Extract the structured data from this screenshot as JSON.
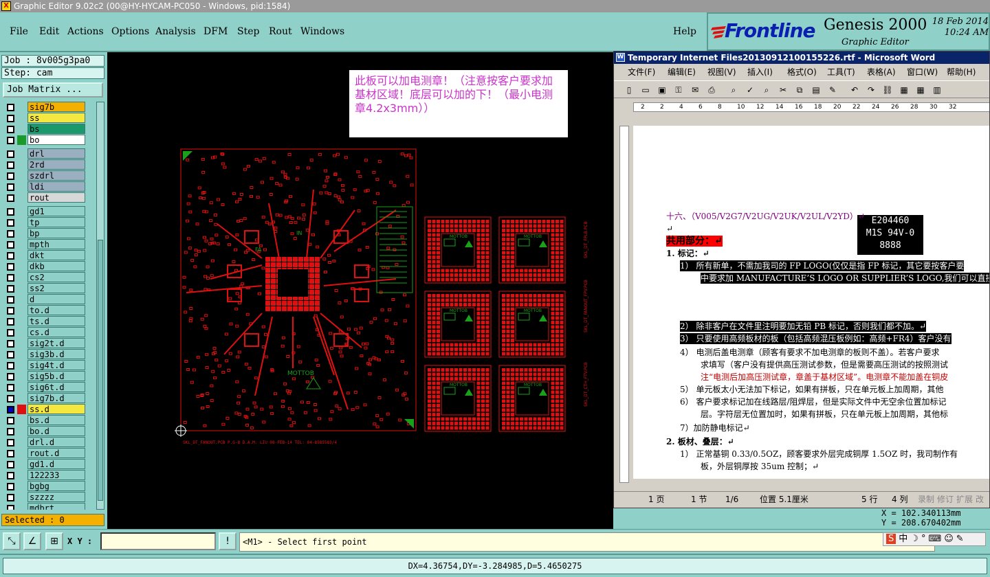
{
  "window": {
    "title": "Graphic Editor 9.02c2 (00@HY-HYCAM-PC050 - Windows, pid:1584)",
    "icon": "X"
  },
  "menu": [
    "File",
    "Edit",
    "Actions",
    "Options",
    "Analysis",
    "DFM",
    "Step",
    "Rout",
    "Windows"
  ],
  "help": "Help",
  "logo": {
    "brand": "Frontline",
    "product": "Genesis 2000",
    "subtitle": "Graphic Editor",
    "date": "18 Feb 2014",
    "time": "10:24 AM"
  },
  "left": {
    "job": "Job : 8v005g3pa0",
    "step": "Step: cam",
    "job_matrix": "Job Matrix ...",
    "selected": "Selected : 0",
    "layers": [
      {
        "name": "sig7b",
        "bg": "#f4b000",
        "sw": ""
      },
      {
        "name": "ss",
        "bg": "#f4e840",
        "sw": ""
      },
      {
        "name": "bs",
        "bg": "#1a9a6a",
        "sw": ""
      },
      {
        "name": "bo",
        "bg": "#ffffff",
        "sw": "#1a9a2a"
      },
      {
        "name": "",
        "bg": "",
        "sw": "",
        "gap": true
      },
      {
        "name": "drl",
        "bg": "#9ab0c0",
        "sw": ""
      },
      {
        "name": "2rd",
        "bg": "#9ab0c0",
        "sw": ""
      },
      {
        "name": "szdrl",
        "bg": "#9ab0c0",
        "sw": ""
      },
      {
        "name": "ldi",
        "bg": "#9ab0c0",
        "sw": ""
      },
      {
        "name": "rout",
        "bg": "#d8d8d8",
        "sw": ""
      },
      {
        "name": "",
        "bg": "",
        "sw": "",
        "gap": true
      },
      {
        "name": "gd1",
        "bg": "#8fd0c8",
        "sw": ""
      },
      {
        "name": "tp",
        "bg": "#8fd0c8",
        "sw": ""
      },
      {
        "name": "bp",
        "bg": "#8fd0c8",
        "sw": ""
      },
      {
        "name": "mpth",
        "bg": "#8fd0c8",
        "sw": ""
      },
      {
        "name": "dkt",
        "bg": "#8fd0c8",
        "sw": ""
      },
      {
        "name": "dkb",
        "bg": "#8fd0c8",
        "sw": ""
      },
      {
        "name": "cs2",
        "bg": "#8fd0c8",
        "sw": ""
      },
      {
        "name": "ss2",
        "bg": "#8fd0c8",
        "sw": ""
      },
      {
        "name": "d",
        "bg": "#8fd0c8",
        "sw": ""
      },
      {
        "name": "to.d",
        "bg": "#8fd0c8",
        "sw": ""
      },
      {
        "name": "ts.d",
        "bg": "#8fd0c8",
        "sw": ""
      },
      {
        "name": "cs.d",
        "bg": "#8fd0c8",
        "sw": ""
      },
      {
        "name": "sig2t.d",
        "bg": "#8fd0c8",
        "sw": ""
      },
      {
        "name": "sig3b.d",
        "bg": "#8fd0c8",
        "sw": ""
      },
      {
        "name": "sig4t.d",
        "bg": "#8fd0c8",
        "sw": ""
      },
      {
        "name": "sig5b.d",
        "bg": "#8fd0c8",
        "sw": ""
      },
      {
        "name": "sig6t.d",
        "bg": "#8fd0c8",
        "sw": ""
      },
      {
        "name": "sig7b.d",
        "bg": "#8fd0c8",
        "sw": ""
      },
      {
        "name": "ss.d",
        "bg": "#f4e840",
        "sw": "#e01010",
        "active": true
      },
      {
        "name": "bs.d",
        "bg": "#8fd0c8",
        "sw": ""
      },
      {
        "name": "bo.d",
        "bg": "#8fd0c8",
        "sw": ""
      },
      {
        "name": "drl.d",
        "bg": "#8fd0c8",
        "sw": ""
      },
      {
        "name": "rout.d",
        "bg": "#8fd0c8",
        "sw": ""
      },
      {
        "name": "gd1.d",
        "bg": "#8fd0c8",
        "sw": ""
      },
      {
        "name": "122233",
        "bg": "#8fd0c8",
        "sw": ""
      },
      {
        "name": "bgbg",
        "bg": "#8fd0c8",
        "sw": ""
      },
      {
        "name": "szzzz",
        "bg": "#8fd0c8",
        "sw": ""
      },
      {
        "name": "mdbrt",
        "bg": "#8fd0c8",
        "sw": ""
      }
    ]
  },
  "canvas": {
    "note": "此板可以加电测章！（注意按客户要求加基材区域！底层可以加的下！（最小电测章4.2x3mm））",
    "pcb_caption": "SKL_DT_FANOUT.PCB     P.G-8     D.A.M. LIU  08-FEB-14  TEL: 04-8585583/4",
    "board_labels": [
      "IN",
      "FA",
      "MOTTOB"
    ],
    "side_labels": [
      "SKL_DT_FPLB.PCB",
      "SKL_DT_FANOUT_FPV.PCB",
      "SKL_DT_CTH_FTV.PCB"
    ],
    "unit_label": "MOTTOB"
  },
  "word": {
    "title": "Temporary Internet Files20130912100155226.rtf - Microsoft Word",
    "menu": [
      "文件(F)",
      "编辑(E)",
      "视图(V)",
      "插入(I)",
      "格式(O)",
      "工具(T)",
      "表格(A)",
      "窗口(W)",
      "帮助(H)"
    ],
    "ruler_nums": [
      "2",
      "2",
      "4",
      "6",
      "8",
      "10",
      "12",
      "14",
      "16",
      "18",
      "20",
      "22",
      "24",
      "26",
      "28",
      "30",
      "32"
    ],
    "lines": [
      {
        "t": "十六、（V005/V2G7/V2UG/V2UK/V2UL/V2YD）↵",
        "c": "#800080"
      },
      {
        "t": "↵",
        "c": "#000"
      },
      {
        "t": "共用部分：↵",
        "c": "#000",
        "bg": "#ff0000"
      },
      {
        "t": "1.  标记：↵",
        "c": "#000",
        "b": true
      },
      {
        "t": "1） 所有新单，不需加我司的 FP LOGO(仅仅是指 FP 标记，其它要按客户要",
        "hl": true
      },
      {
        "t": "中要求加 MANUFACTURE’S LOGO OR SUPPLIER’S LOGO,我们可以直接",
        "hl": true
      },
      {
        "t": "2） 除非客户在文件里注明要加无铅 PB 标记，否则我们都不加。↵",
        "hl": true
      },
      {
        "t": "3） 只要使用高频板材的板（包括高频混压板例如：高频+FR4）客户没有",
        "hl": true
      },
      {
        "t": "4） 电测后盖电测章（顾客有要求不加电测章的板则不盖）。若客户要求",
        "c": "#000"
      },
      {
        "t": "求填写（客户没有提供高压测试参数，但是需要高压测试的按照测试",
        "c": "#000"
      },
      {
        "t": "注“电测后加高压测试章，章盖于基材区域”。电测章不能加盖在铜皮",
        "c": "#c00000"
      },
      {
        "t": "5） 单元板太小无法加下标记，如果有拼板，只在单元板上加周期，其他",
        "c": "#000"
      },
      {
        "t": "6） 客户要求标记加在线路层/阻焊层，但是实际文件中无空余位置加标记",
        "c": "#000"
      },
      {
        "t": "层。字符层无位置加时，如果有拼板，只在单元板上加周期，其他标",
        "c": "#000"
      },
      {
        "t": "7）加防静电标记↵",
        "c": "#000"
      },
      {
        "t": "2.  板材、叠层：↵",
        "c": "#000",
        "b": true
      },
      {
        "t": "1） 正常基铜 0.33/0.5OZ，顾客要求外层完成铜厚 1.5OZ 时，我司制作有",
        "c": "#000"
      },
      {
        "t": "板，外层铜厚按 35um 控制；↵",
        "c": "#000"
      }
    ],
    "logo_block": [
      "E204460",
      "M1S 94V-0",
      "8888"
    ],
    "status": {
      "page": "1 页",
      "section": "1 节",
      "pages": "1/6",
      "pos": "位置 5.1厘米",
      "line": "5 行",
      "col": "4 列",
      "rec": "录制",
      "trk": "修订",
      "ext": "扩展",
      "ovr": "改写"
    }
  },
  "coords": {
    "x": "X = 102.340113mm",
    "y": "Y = 208.670402mm"
  },
  "bottom": {
    "xy_label": "X Y :",
    "xy_value": "",
    "prompt": "<M1> - Select first point",
    "status": "DX=4.36754,DY=-3.284985,D=5.4650275",
    "ime": "中"
  },
  "colors": {
    "panel": "#8fd0c8",
    "pcb_red": "#e01010",
    "pcb_green": "#1aa01a"
  }
}
